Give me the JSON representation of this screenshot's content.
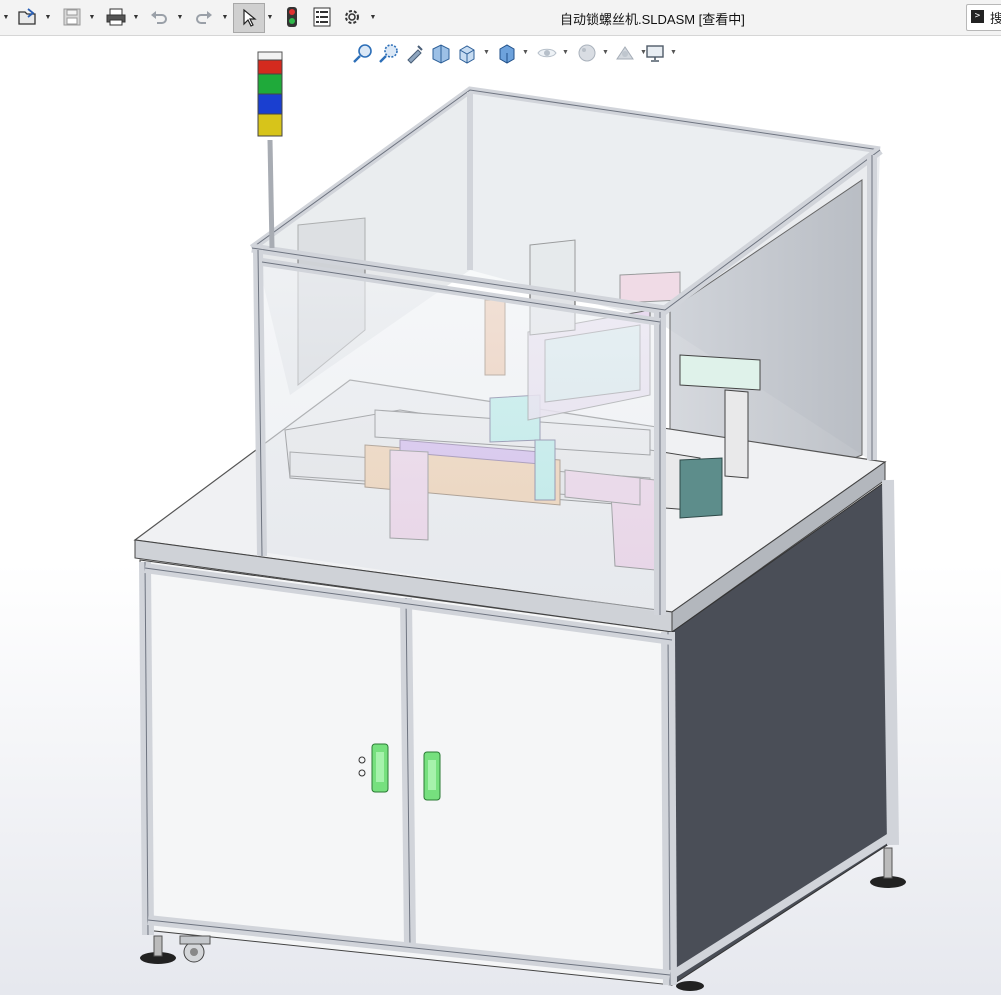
{
  "window": {
    "title": "自动锁螺丝机.SLDASM [查看中]"
  },
  "toolbar": {
    "items": [
      {
        "name": "menu-caret",
        "icon": "chevron-down-icon"
      },
      {
        "name": "open-button",
        "icon": "open-folder-icon"
      },
      {
        "name": "save-button",
        "icon": "save-icon"
      },
      {
        "name": "print-button",
        "icon": "print-icon"
      },
      {
        "name": "undo-button",
        "icon": "undo-icon"
      },
      {
        "name": "redo-button",
        "icon": "redo-icon"
      },
      {
        "name": "select-button",
        "icon": "cursor-arrow-icon"
      },
      {
        "name": "traffic-light-button",
        "icon": "traffic-light-icon"
      },
      {
        "name": "file-properties-button",
        "icon": "file-properties-icon"
      },
      {
        "name": "options-button",
        "icon": "gear-icon"
      }
    ],
    "search_label": "搜"
  },
  "heads_up": {
    "items": [
      "zoom-to-fit-icon",
      "zoom-to-area-icon",
      "previous-view-icon",
      "section-view-icon",
      "view-orientation-icon",
      "display-style-icon",
      "hide-show-items-icon",
      "edit-appearance-icon",
      "apply-scene-icon",
      "view-settings-icon"
    ]
  },
  "scene": {
    "model": "automatic-screw-locking-machine",
    "stack_light_colors": [
      "#d42a1e",
      "#1faa3a",
      "#1a3fd0",
      "#d7c41a"
    ],
    "frame_color": "#c9ccd3",
    "cabinet_side_color": "#4a4e57",
    "handle_color": "#76e07e"
  }
}
